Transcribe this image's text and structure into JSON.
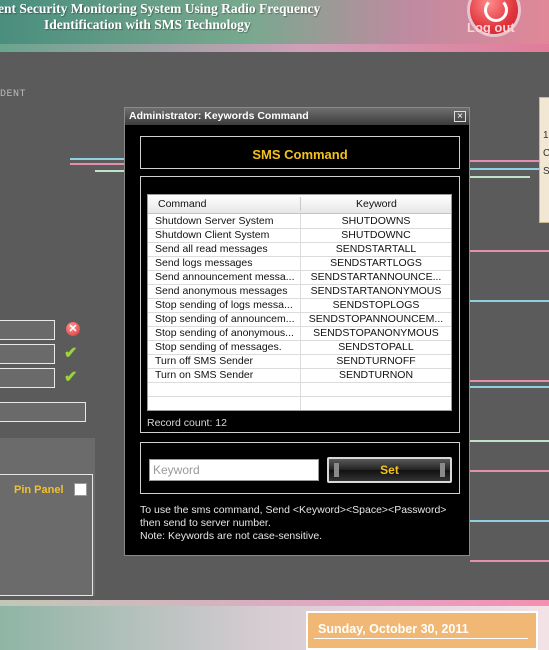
{
  "header": {
    "title_line1": "ent Security Monitoring System Using Radio Frequency",
    "title_line2": "Identification with SMS Technology",
    "logout_label": "Log out"
  },
  "background": {
    "partial_label": "DENT",
    "right_panel_chars": [
      "1",
      "C",
      "S"
    ]
  },
  "left_panel": {
    "pin_panel_label": "Pin Panel"
  },
  "clock": {
    "date": "Sunday, October 30, 2011"
  },
  "dialog": {
    "title": "Administrator: Keywords Command",
    "close_label": "×",
    "header_label": "SMS Command",
    "columns": [
      "Command",
      "Keyword"
    ],
    "rows": [
      {
        "command": "Shutdown Server System",
        "keyword": "SHUTDOWNS"
      },
      {
        "command": "Shutdown Client System",
        "keyword": "SHUTDOWNC"
      },
      {
        "command": "Send all read messages",
        "keyword": "SENDSTARTALL"
      },
      {
        "command": "Send logs messages",
        "keyword": "SENDSTARTLOGS"
      },
      {
        "command": "Send announcement messa...",
        "keyword": "SENDSTARTANNOUNCE..."
      },
      {
        "command": "Send anonymous messages",
        "keyword": "SENDSTARTANONYMOUS"
      },
      {
        "command": "Stop sending of logs messa...",
        "keyword": "SENDSTOPLOGS"
      },
      {
        "command": "Stop sending of announcem...",
        "keyword": "SENDSTOPANNOUNCEM..."
      },
      {
        "command": "Stop sending of anonymous...",
        "keyword": "SENDSTOPANONYMOUS"
      },
      {
        "command": "Stop sending of messages.",
        "keyword": "SENDSTOPALL"
      },
      {
        "command": "Turn off SMS Sender",
        "keyword": "SENDTURNOFF"
      },
      {
        "command": "Turn on SMS Sender",
        "keyword": "SENDTURNON"
      },
      {
        "command": "",
        "keyword": ""
      },
      {
        "command": "",
        "keyword": ""
      }
    ],
    "record_count": "Record count: 12",
    "keyword_placeholder": "Keyword",
    "set_label": "Set",
    "help_line1": "To use the sms command, Send <Keyword><Space><Password>",
    "help_line2": "then send to server number.",
    "help_line3": "Note: Keywords are not case-sensitive."
  },
  "colors": {
    "accent_yellow": "#f4c21c",
    "dialog_bg": "#000000",
    "page_bg": "#5b5b5b"
  }
}
